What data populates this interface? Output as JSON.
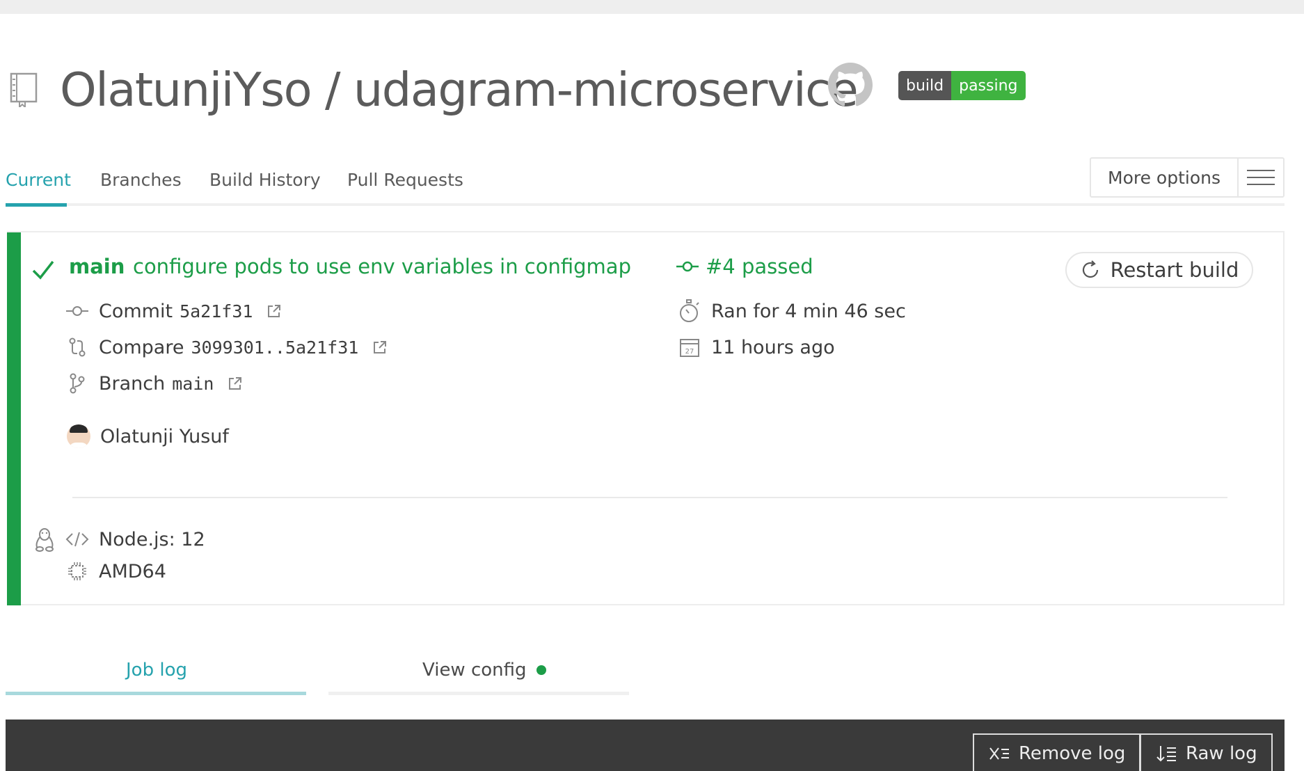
{
  "header": {
    "repo_title": "OlatunjiYso / udagram-microservice",
    "badge_left": "build",
    "badge_right": "passing"
  },
  "tabs": [
    {
      "label": "Current",
      "active": true
    },
    {
      "label": "Branches",
      "active": false
    },
    {
      "label": "Build History",
      "active": false
    },
    {
      "label": "Pull Requests",
      "active": false
    }
  ],
  "more_options": {
    "label": "More options"
  },
  "build": {
    "branch": "main",
    "commit_message": "configure pods to use env variables in configmap",
    "status": "#4 passed",
    "restart_label": "Restart build",
    "commit_label": "Commit",
    "commit_sha": "5a21f31",
    "compare_label": "Compare",
    "compare_range": "3099301..5a21f31",
    "branch_label": "Branch",
    "branch_value": "main",
    "author": "Olatunji Yusuf",
    "duration": "Ran for 4 min 46 sec",
    "finished": "11 hours ago",
    "language": "Node.js: 12",
    "arch": "AMD64"
  },
  "log_tabs": {
    "job_log": "Job log",
    "view_config": "View config"
  },
  "log_actions": {
    "remove_log": "Remove log",
    "raw_log": "Raw log"
  },
  "colors": {
    "passed_green": "#1c9d48",
    "accent_teal": "#25a2ad",
    "badge_green": "#3fb340",
    "badge_gray": "#555555",
    "log_background": "#3a3a3a"
  },
  "icons": [
    "repo-icon",
    "github-icon",
    "hamburger-icon",
    "check-icon",
    "commit-icon",
    "restart-icon",
    "compare-icon",
    "branch-icon",
    "external-link-icon",
    "stopwatch-icon",
    "calendar-icon",
    "linux-icon",
    "code-icon",
    "cpu-icon",
    "remove-log-icon",
    "raw-log-icon"
  ]
}
